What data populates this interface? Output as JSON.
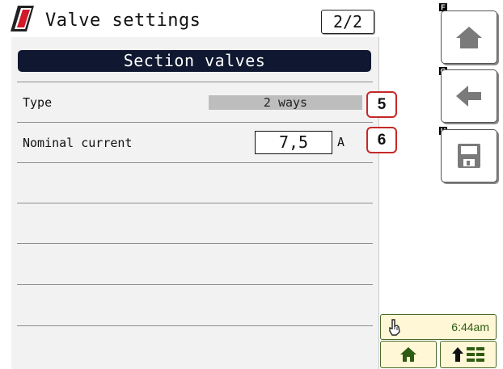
{
  "window": {
    "title": "Valve settings",
    "page_indicator": "2/2"
  },
  "section": {
    "header": "Section valves"
  },
  "settings": [
    {
      "label": "Type",
      "value": "2 ways",
      "callout": "5"
    },
    {
      "label": "Nominal current",
      "value": "7,5",
      "unit": "A",
      "callout": "6"
    }
  ],
  "side_buttons": [
    {
      "letter": "F",
      "icon": "home-icon"
    },
    {
      "letter": "G",
      "icon": "back-arrow-icon"
    },
    {
      "letter": "H",
      "icon": "save-icon"
    }
  ],
  "status_bar": {
    "time": "6:44am"
  },
  "colors": {
    "header_bg": "#0f1830",
    "callout_border": "#c62828",
    "status_bg": "#fff7d6"
  }
}
